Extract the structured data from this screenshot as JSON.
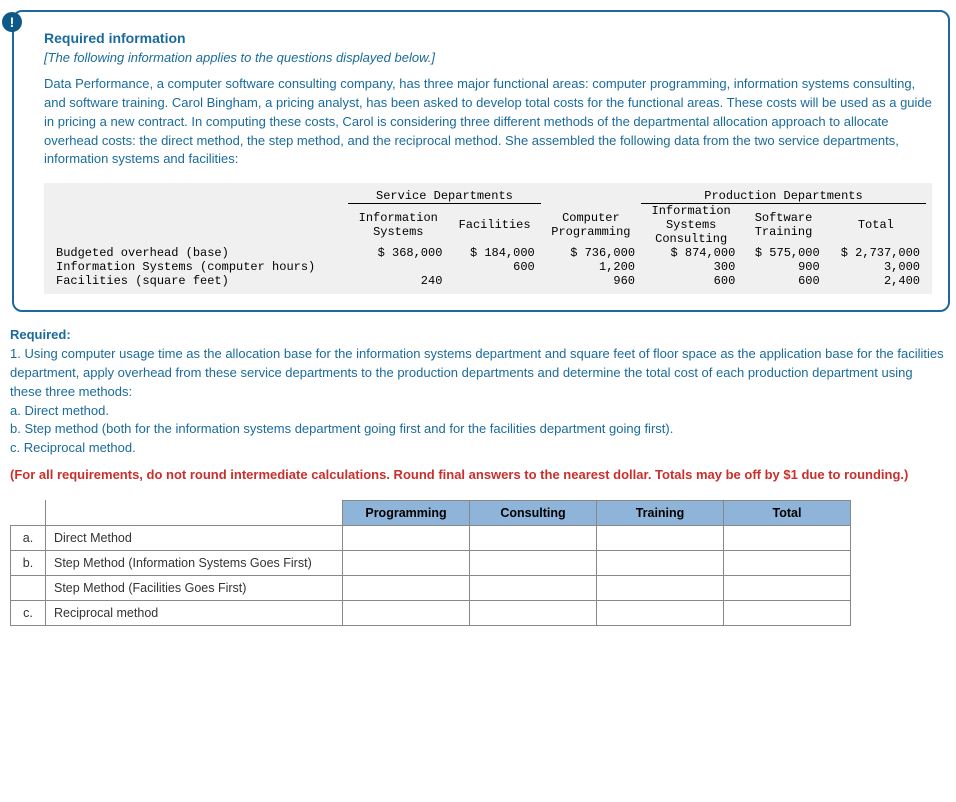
{
  "badge": "!",
  "card": {
    "heading": "Required information",
    "subhead": "[The following information applies to the questions displayed below.]",
    "body": "Data Performance, a computer software consulting company, has three major functional areas: computer programming, information systems consulting, and software training. Carol Bingham, a pricing analyst, has been asked to develop total costs for the functional areas. These costs will be used as a guide in pricing a new contract. In computing these costs, Carol is considering three different methods of the departmental allocation approach to allocate overhead costs: the direct method, the step method, and the reciprocal method. She assembled the following data from the two service departments, information systems and facilities:"
  },
  "chart_data": {
    "type": "table",
    "group_headers": {
      "service": "Service Departments",
      "production": "Production Departments"
    },
    "columns": [
      "Information Systems",
      "Facilities",
      "Computer Programming",
      "Information Systems Consulting",
      "Software Training",
      "Total"
    ],
    "rows": [
      {
        "label": "Budgeted overhead (base)",
        "values": [
          "$ 368,000",
          "$ 184,000",
          "$ 736,000",
          "$ 874,000",
          "$ 575,000",
          "$ 2,737,000"
        ]
      },
      {
        "label": "Information Systems (computer hours)",
        "values": [
          "",
          "600",
          "1,200",
          "300",
          "900",
          "3,000"
        ]
      },
      {
        "label": "Facilities (square feet)",
        "values": [
          "240",
          "",
          "960",
          "600",
          "600",
          "2,400"
        ]
      }
    ]
  },
  "required": {
    "heading": "Required:",
    "intro": "1. Using computer usage time as the allocation base for the information systems department and square feet of floor space as the application base for the facilities department, apply overhead from these service departments to the production departments and determine the total cost of each production department using these three methods:",
    "a": "a. Direct method.",
    "b": "b. Step method (both for the information systems department going first and for the facilities department going first).",
    "c": "c. Reciprocal method."
  },
  "rounding_note": "(For all requirements, do not round intermediate calculations. Round final answers to the nearest dollar. Totals may be off by $1 due to rounding.)",
  "answer_table": {
    "headers": [
      "Programming",
      "Consulting",
      "Training",
      "Total"
    ],
    "rows": [
      {
        "key": "a.",
        "label": "Direct Method"
      },
      {
        "key": "b.",
        "label": "Step Method (Information Systems Goes First)"
      },
      {
        "key": "",
        "label": "Step Method (Facilities Goes First)"
      },
      {
        "key": "c.",
        "label": "Reciprocal method"
      }
    ]
  }
}
